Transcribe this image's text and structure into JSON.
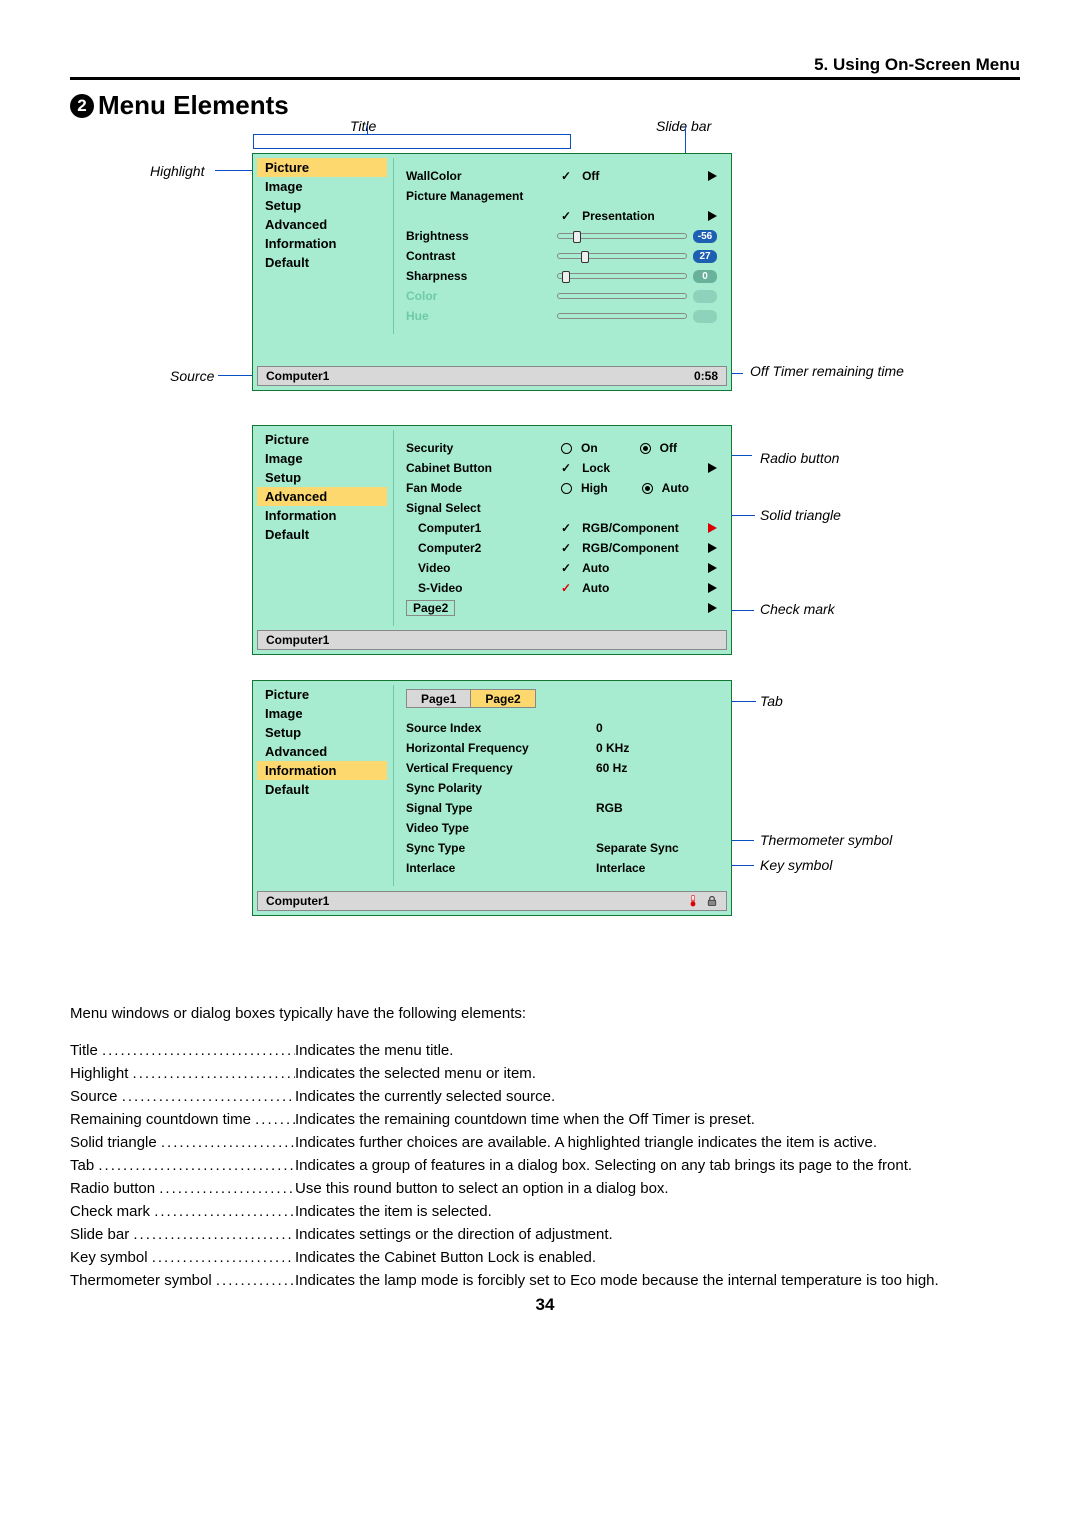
{
  "chapter": "5. Using On-Screen Menu",
  "section_title": "Menu Elements",
  "section_number": "2",
  "callouts": {
    "title": "Title",
    "slidebar": "Slide bar",
    "highlight": "Highlight",
    "source": "Source",
    "off_timer": "Off Timer remaining time",
    "radio": "Radio button",
    "solid_tri": "Solid triangle",
    "check": "Check mark",
    "tab": "Tab",
    "therm": "Thermometer symbol",
    "key": "Key symbol"
  },
  "osd1": {
    "side_items": [
      "Picture",
      "Image",
      "Setup",
      "Advanced",
      "Information",
      "Default"
    ],
    "side_hl": 0,
    "status_left": "Computer1",
    "status_right": "0:58",
    "wallcolor": "WallColor",
    "wallcolor_val": "Off",
    "picman": "Picture Management",
    "picman_val": "Presentation",
    "brightness": "Brightness",
    "brightness_val": "-56",
    "contrast": "Contrast",
    "contrast_val": "27",
    "sharpness": "Sharpness",
    "sharpness_val": "0",
    "color": "Color",
    "hue": "Hue"
  },
  "osd2": {
    "side_items": [
      "Picture",
      "Image",
      "Setup",
      "Advanced",
      "Information",
      "Default"
    ],
    "side_hl": 3,
    "status_left": "Computer1",
    "security": "Security",
    "on": "On",
    "off": "Off",
    "cabinet": "Cabinet Button",
    "lock": "Lock",
    "fan": "Fan Mode",
    "high": "High",
    "auto": "Auto",
    "sigsel": "Signal Select",
    "comp1": "Computer1",
    "comp2": "Computer2",
    "rgbc": "RGB/Component",
    "video": "Video",
    "svideo": "S-Video",
    "page2": "Page2"
  },
  "osd3": {
    "side_items": [
      "Picture",
      "Image",
      "Setup",
      "Advanced",
      "Information",
      "Default"
    ],
    "side_hl": 4,
    "status_left": "Computer1",
    "page1": "Page1",
    "page2": "Page2",
    "rows": {
      "src_index": "Source Index",
      "src_index_v": "0",
      "hfreq": "Horizontal Frequency",
      "hfreq_v": "0 KHz",
      "vfreq": "Vertical Frequency",
      "vfreq_v": "60 Hz",
      "syncpol": "Sync Polarity",
      "syncpol_v": "",
      "sigtype": "Signal Type",
      "sigtype_v": "RGB",
      "vidtype": "Video Type",
      "vidtype_v": "",
      "synctype": "Sync Type",
      "synctype_v": "Separate Sync",
      "interlace": "Interlace",
      "interlace_v": "Interlace"
    }
  },
  "intro": "Menu windows or dialog boxes typically have the following elements:",
  "defs": [
    {
      "term": "Title",
      "def": "Indicates the menu title."
    },
    {
      "term": "Highlight",
      "def": "Indicates the selected menu or item."
    },
    {
      "term": "Source",
      "def": "Indicates the currently selected source."
    },
    {
      "term": "Remaining countdown time",
      "def": "Indicates the remaining countdown time when the Off Timer is preset."
    },
    {
      "term": "Solid triangle",
      "def": "Indicates further choices are available. A highlighted triangle indicates the item is active."
    },
    {
      "term": "Tab",
      "def": "Indicates a group of features in a dialog box. Selecting on any tab brings its page to the front."
    },
    {
      "term": "Radio button",
      "def": "Use this round button to select an option in a dialog box."
    },
    {
      "term": "Check mark",
      "def": "Indicates the item is selected."
    },
    {
      "term": "Slide bar",
      "def": "Indicates settings or the direction of adjustment."
    },
    {
      "term": "Key symbol",
      "def": "Indicates the Cabinet Button Lock is enabled."
    },
    {
      "term": "Thermometer symbol",
      "def": "Indicates the lamp mode is forcibly set to Eco mode because the internal temperature is too high."
    }
  ],
  "page_number": "34"
}
